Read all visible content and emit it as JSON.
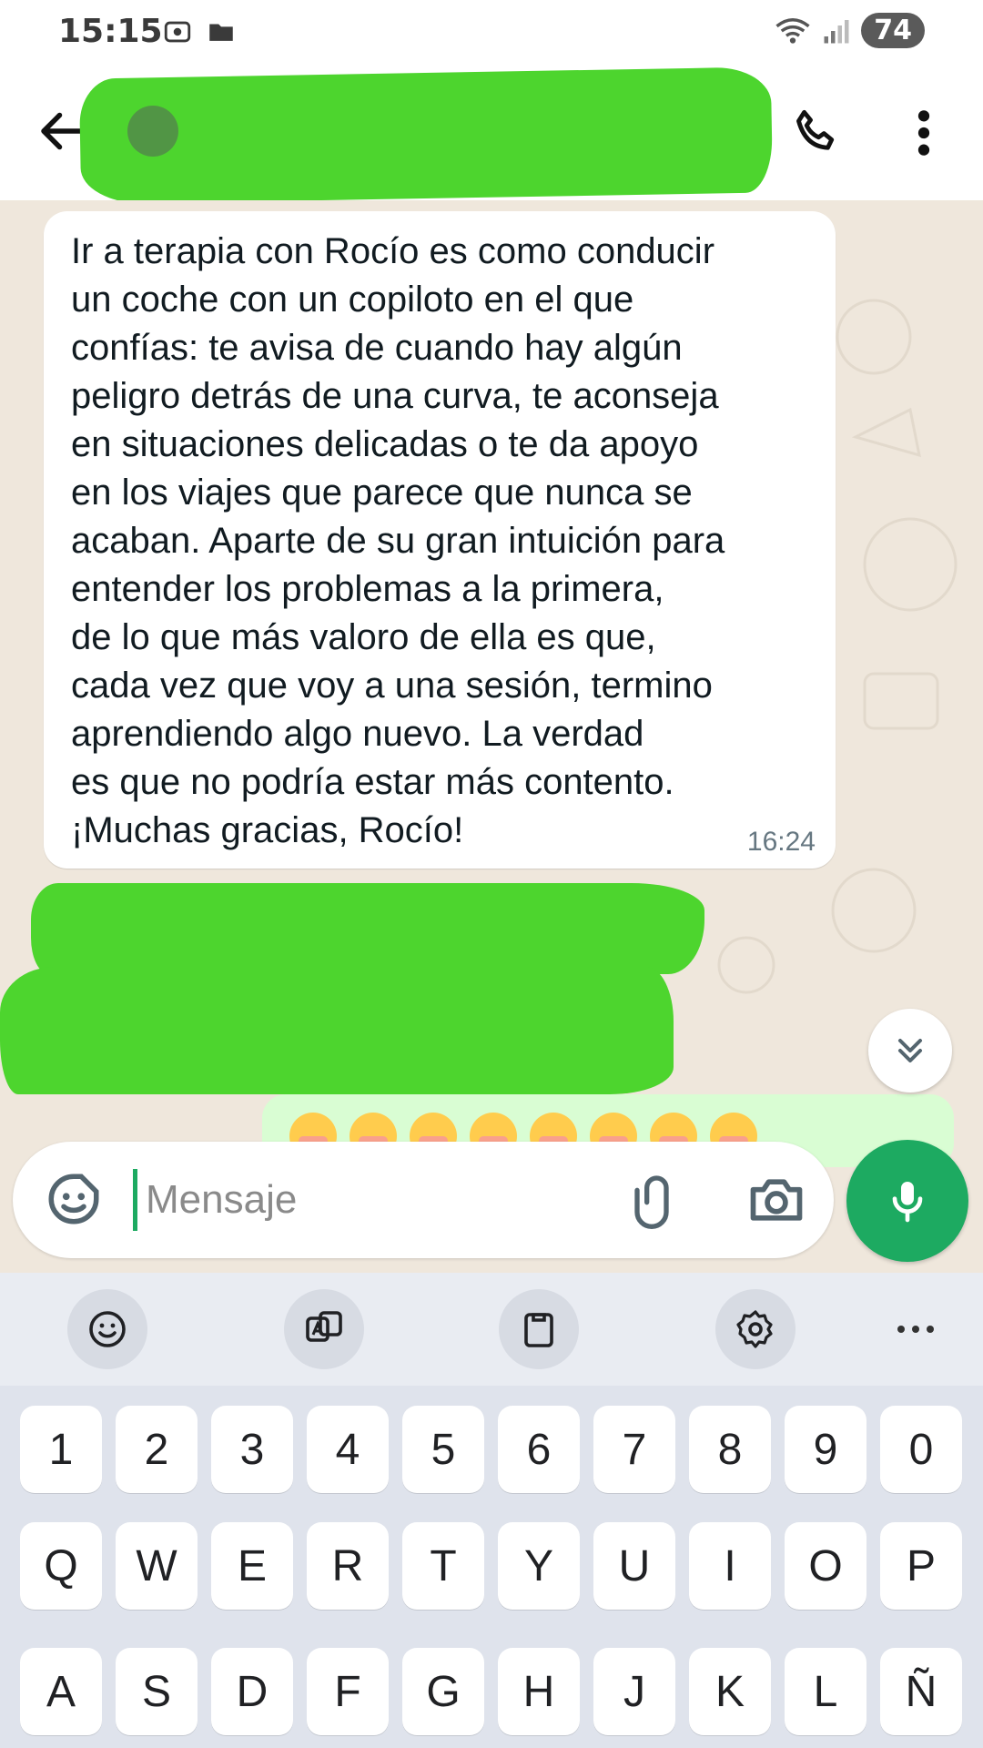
{
  "status_bar": {
    "time": "15:15",
    "left_icons": [
      "screenshot-icon",
      "folder-icon"
    ],
    "right_icons": [
      "wifi-icon",
      "signal-icon"
    ],
    "battery": "74"
  },
  "header": {
    "back_icon": "arrow-left-icon",
    "contact_name": "",
    "call_icon": "phone-icon",
    "menu_icon": "more-vertical-icon"
  },
  "chat": {
    "messages": [
      {
        "direction": "incoming",
        "text": "Ir a terapia con Rocío es como conducir\nun coche con un copiloto en el que\nconfías: te avisa de cuando hay algún\npeligro detrás de una curva, te aconseja\nen situaciones delicadas o te da apoyo\nen los viajes que parece que nunca se\nacaban. Aparte de su gran intuición para\nentender los problemas a la primera,\nde lo que más valoro de ella es que,\ncada vez que voy a una sesión, termino\naprendiendo algo nuevo. La verdad\nes que no podría estar más contento.\n¡Muchas gracias, Rocío!",
        "time": "16:24"
      }
    ],
    "outgoing_preview_emoji": "😍😍😍😍😍😍😍😍",
    "scroll_down_icon": "double-chevron-down-icon"
  },
  "composer": {
    "placeholder": "Mensaje",
    "value": "",
    "sticker_icon": "sticker-icon",
    "attach_icon": "paperclip-icon",
    "camera_icon": "camera-icon",
    "mic_icon": "microphone-icon"
  },
  "keyboard": {
    "toolbar": [
      "emoji-icon",
      "translate-icon",
      "clipboard-icon",
      "settings-icon",
      "more-horizontal-icon"
    ],
    "row_numbers": [
      "1",
      "2",
      "3",
      "4",
      "5",
      "6",
      "7",
      "8",
      "9",
      "0"
    ],
    "row_qwerty": [
      "Q",
      "W",
      "E",
      "R",
      "T",
      "Y",
      "U",
      "I",
      "O",
      "P"
    ],
    "row_asdf": [
      "A",
      "S",
      "D",
      "F",
      "G",
      "H",
      "J",
      "K",
      "L",
      "Ñ"
    ]
  },
  "colors": {
    "accent_green": "#1daa61",
    "redaction_green": "#4dd52e",
    "chat_background": "#efe7dc",
    "outgoing_bubble": "#d9fdd3"
  }
}
